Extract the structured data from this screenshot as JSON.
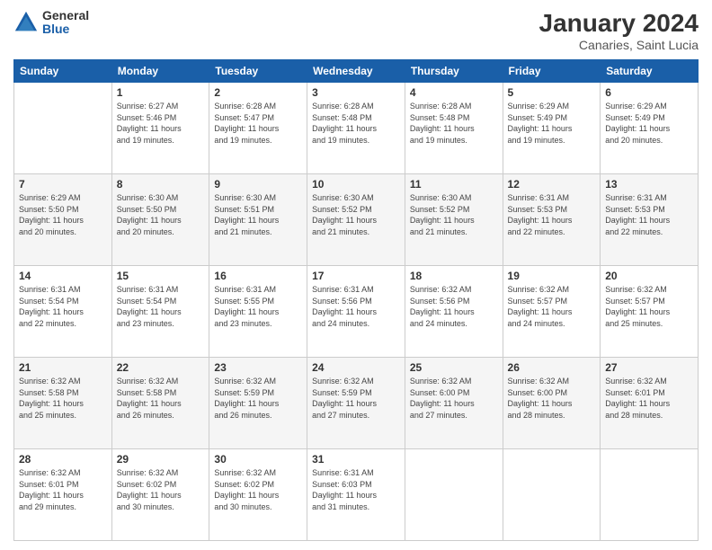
{
  "logo": {
    "general": "General",
    "blue": "Blue"
  },
  "title": "January 2024",
  "subtitle": "Canaries, Saint Lucia",
  "days_of_week": [
    "Sunday",
    "Monday",
    "Tuesday",
    "Wednesday",
    "Thursday",
    "Friday",
    "Saturday"
  ],
  "weeks": [
    [
      {
        "day": "",
        "info": ""
      },
      {
        "day": "1",
        "info": "Sunrise: 6:27 AM\nSunset: 5:46 PM\nDaylight: 11 hours\nand 19 minutes."
      },
      {
        "day": "2",
        "info": "Sunrise: 6:28 AM\nSunset: 5:47 PM\nDaylight: 11 hours\nand 19 minutes."
      },
      {
        "day": "3",
        "info": "Sunrise: 6:28 AM\nSunset: 5:48 PM\nDaylight: 11 hours\nand 19 minutes."
      },
      {
        "day": "4",
        "info": "Sunrise: 6:28 AM\nSunset: 5:48 PM\nDaylight: 11 hours\nand 19 minutes."
      },
      {
        "day": "5",
        "info": "Sunrise: 6:29 AM\nSunset: 5:49 PM\nDaylight: 11 hours\nand 19 minutes."
      },
      {
        "day": "6",
        "info": "Sunrise: 6:29 AM\nSunset: 5:49 PM\nDaylight: 11 hours\nand 20 minutes."
      }
    ],
    [
      {
        "day": "7",
        "info": "Sunrise: 6:29 AM\nSunset: 5:50 PM\nDaylight: 11 hours\nand 20 minutes."
      },
      {
        "day": "8",
        "info": "Sunrise: 6:30 AM\nSunset: 5:50 PM\nDaylight: 11 hours\nand 20 minutes."
      },
      {
        "day": "9",
        "info": "Sunrise: 6:30 AM\nSunset: 5:51 PM\nDaylight: 11 hours\nand 21 minutes."
      },
      {
        "day": "10",
        "info": "Sunrise: 6:30 AM\nSunset: 5:52 PM\nDaylight: 11 hours\nand 21 minutes."
      },
      {
        "day": "11",
        "info": "Sunrise: 6:30 AM\nSunset: 5:52 PM\nDaylight: 11 hours\nand 21 minutes."
      },
      {
        "day": "12",
        "info": "Sunrise: 6:31 AM\nSunset: 5:53 PM\nDaylight: 11 hours\nand 22 minutes."
      },
      {
        "day": "13",
        "info": "Sunrise: 6:31 AM\nSunset: 5:53 PM\nDaylight: 11 hours\nand 22 minutes."
      }
    ],
    [
      {
        "day": "14",
        "info": "Sunrise: 6:31 AM\nSunset: 5:54 PM\nDaylight: 11 hours\nand 22 minutes."
      },
      {
        "day": "15",
        "info": "Sunrise: 6:31 AM\nSunset: 5:54 PM\nDaylight: 11 hours\nand 23 minutes."
      },
      {
        "day": "16",
        "info": "Sunrise: 6:31 AM\nSunset: 5:55 PM\nDaylight: 11 hours\nand 23 minutes."
      },
      {
        "day": "17",
        "info": "Sunrise: 6:31 AM\nSunset: 5:56 PM\nDaylight: 11 hours\nand 24 minutes."
      },
      {
        "day": "18",
        "info": "Sunrise: 6:32 AM\nSunset: 5:56 PM\nDaylight: 11 hours\nand 24 minutes."
      },
      {
        "day": "19",
        "info": "Sunrise: 6:32 AM\nSunset: 5:57 PM\nDaylight: 11 hours\nand 24 minutes."
      },
      {
        "day": "20",
        "info": "Sunrise: 6:32 AM\nSunset: 5:57 PM\nDaylight: 11 hours\nand 25 minutes."
      }
    ],
    [
      {
        "day": "21",
        "info": "Sunrise: 6:32 AM\nSunset: 5:58 PM\nDaylight: 11 hours\nand 25 minutes."
      },
      {
        "day": "22",
        "info": "Sunrise: 6:32 AM\nSunset: 5:58 PM\nDaylight: 11 hours\nand 26 minutes."
      },
      {
        "day": "23",
        "info": "Sunrise: 6:32 AM\nSunset: 5:59 PM\nDaylight: 11 hours\nand 26 minutes."
      },
      {
        "day": "24",
        "info": "Sunrise: 6:32 AM\nSunset: 5:59 PM\nDaylight: 11 hours\nand 27 minutes."
      },
      {
        "day": "25",
        "info": "Sunrise: 6:32 AM\nSunset: 6:00 PM\nDaylight: 11 hours\nand 27 minutes."
      },
      {
        "day": "26",
        "info": "Sunrise: 6:32 AM\nSunset: 6:00 PM\nDaylight: 11 hours\nand 28 minutes."
      },
      {
        "day": "27",
        "info": "Sunrise: 6:32 AM\nSunset: 6:01 PM\nDaylight: 11 hours\nand 28 minutes."
      }
    ],
    [
      {
        "day": "28",
        "info": "Sunrise: 6:32 AM\nSunset: 6:01 PM\nDaylight: 11 hours\nand 29 minutes."
      },
      {
        "day": "29",
        "info": "Sunrise: 6:32 AM\nSunset: 6:02 PM\nDaylight: 11 hours\nand 30 minutes."
      },
      {
        "day": "30",
        "info": "Sunrise: 6:32 AM\nSunset: 6:02 PM\nDaylight: 11 hours\nand 30 minutes."
      },
      {
        "day": "31",
        "info": "Sunrise: 6:31 AM\nSunset: 6:03 PM\nDaylight: 11 hours\nand 31 minutes."
      },
      {
        "day": "",
        "info": ""
      },
      {
        "day": "",
        "info": ""
      },
      {
        "day": "",
        "info": ""
      }
    ]
  ]
}
